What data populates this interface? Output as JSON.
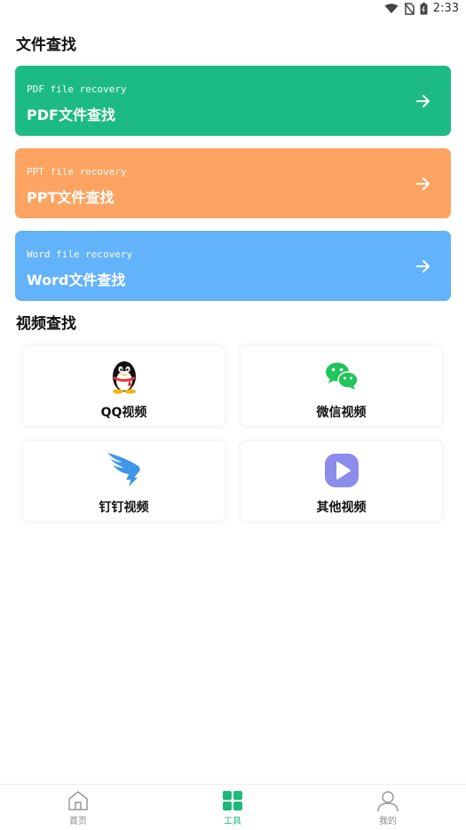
{
  "status": {
    "time": "2:33"
  },
  "sections": {
    "file_search": "文件查找",
    "video_search": "视频查找"
  },
  "file_cards": [
    {
      "en": "PDF file recovery",
      "zh": "PDF文件查找",
      "color": "#1DBB84"
    },
    {
      "en": "PPT file recovery",
      "zh": "PPT文件查找",
      "color": "#FDA462"
    },
    {
      "en": "Word file recovery",
      "zh": "Word文件查找",
      "color": "#63B3FA"
    }
  ],
  "video_cards": [
    {
      "label": "QQ视频",
      "icon": "qq-penguin-icon"
    },
    {
      "label": "微信视频",
      "icon": "wechat-icon"
    },
    {
      "label": "钉钉视频",
      "icon": "dingtalk-icon"
    },
    {
      "label": "其他视频",
      "icon": "play-icon"
    }
  ],
  "nav": [
    {
      "label": "首页",
      "icon": "home-icon"
    },
    {
      "label": "工具",
      "icon": "grid-icon",
      "active": true
    },
    {
      "label": "我的",
      "icon": "user-icon"
    }
  ],
  "colors": {
    "accent": "#1DB87A",
    "inactive": "#888888"
  }
}
